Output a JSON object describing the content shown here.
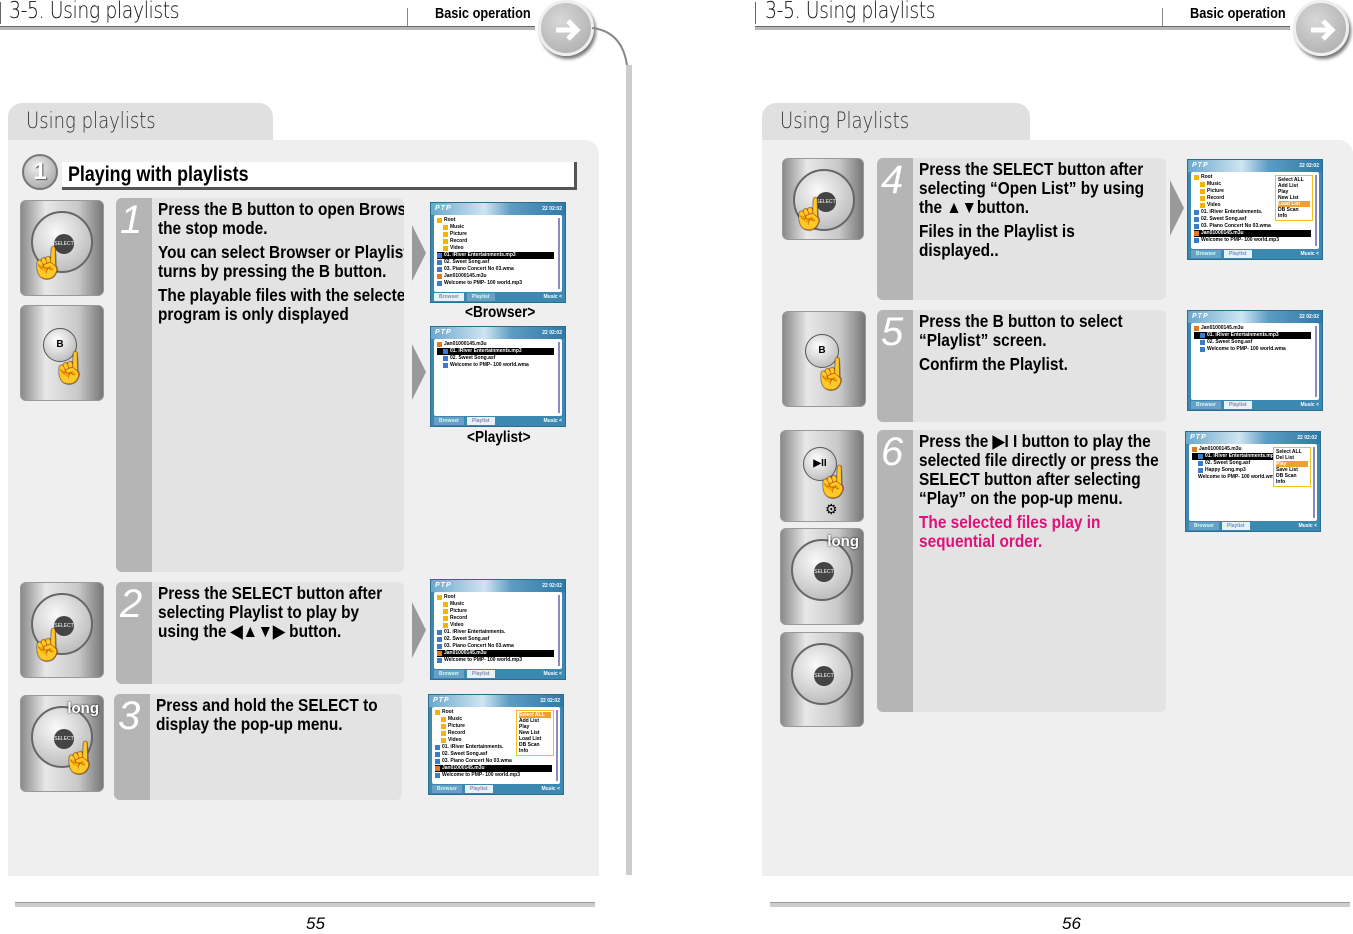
{
  "left_page": {
    "header": {
      "title": "3-5. Using playlists",
      "section": "Basic operation"
    },
    "tab": "Using playlists",
    "section_number": "1",
    "section_title": "Playing with playlists",
    "steps": [
      {
        "number": "1",
        "paragraphs": [
          "Press the B button to open Browser at the stop mode.",
          "You can select Browser or Playlist by turns by pressing the B button.",
          "The playable files with the selected program is only displayed"
        ]
      },
      {
        "number": "2",
        "paragraphs": [
          "Press the SELECT button after selecting Playlist to play by using the ◀▲▼▶ button."
        ]
      },
      {
        "number": "3",
        "paragraphs": [
          "Press and hold the SELECT to display the pop-up menu."
        ]
      }
    ],
    "captions": {
      "browser": "<Browser>",
      "playlist": "<Playlist>"
    },
    "page_number": "55"
  },
  "right_page": {
    "header": {
      "title": "3-5. Using playlists",
      "section": "Basic operation"
    },
    "tab": "Using Playlists",
    "steps": [
      {
        "number": "4",
        "paragraphs": [
          "Press the SELECT button after selecting “Open List” by using the ▲▼button.",
          "Files in the Playlist is displayed.."
        ]
      },
      {
        "number": "5",
        "paragraphs": [
          "Press the B button to select “Playlist” screen.",
          "Confirm the Playlist."
        ]
      },
      {
        "number": "6",
        "paragraphs": [
          "Press the ▶I I button to play the selected file directly or press the SELECT button after selecting “Play” on the pop-up menu."
        ],
        "note": "The selected files play in sequential order."
      }
    ],
    "page_number": "56"
  },
  "device_labels": {
    "select": "SELECT",
    "b": "B",
    "long": "long"
  },
  "screen_common": {
    "logo": "PTP",
    "status": "22 02:02",
    "tabs": [
      "Browser",
      "Playlist"
    ],
    "mode": "Music <"
  },
  "screens": {
    "s1_browser": {
      "active": "Browser",
      "rows": [
        {
          "t": "Root",
          "i": "folder"
        },
        {
          "t": "Music",
          "i": "folder",
          "d": 1
        },
        {
          "t": "Picture",
          "i": "folder",
          "d": 1
        },
        {
          "t": "Record",
          "i": "folder",
          "d": 1
        },
        {
          "t": "Video",
          "i": "folder",
          "d": 1
        },
        {
          "t": "01. iRiver Entertainments.mp3",
          "i": "file",
          "sel": true
        },
        {
          "t": "02. Sweet Song.asf",
          "i": "file"
        },
        {
          "t": "03. Piano Concert No 03.wma",
          "i": "file"
        },
        {
          "t": "Jan01000145.m3u",
          "i": "list"
        },
        {
          "t": "Welcome to PMP- 100 world.mp3",
          "i": "file"
        }
      ]
    },
    "s1_playlist": {
      "active": "Playlist",
      "rows": [
        {
          "t": "Jan01000145.m3u",
          "i": "list"
        },
        {
          "t": "01. iRiver Entertainments.mp3",
          "i": "file",
          "sel": true,
          "d": 1
        },
        {
          "t": "02. Sweet Song.asf",
          "i": "file",
          "d": 1
        },
        {
          "t": "Welcome to PMP- 100 world.wma",
          "i": "file",
          "d": 1
        }
      ]
    },
    "s2": {
      "active": "Playlist",
      "rows": [
        {
          "t": "Root",
          "i": "folder"
        },
        {
          "t": "Music",
          "i": "folder",
          "d": 1
        },
        {
          "t": "Picture",
          "i": "folder",
          "d": 1
        },
        {
          "t": "Record",
          "i": "folder",
          "d": 1
        },
        {
          "t": "Video",
          "i": "folder",
          "d": 1
        },
        {
          "t": "01. iRiver Entertainments.",
          "i": "file"
        },
        {
          "t": "02. Sweet Song.asf",
          "i": "file"
        },
        {
          "t": "03. Piano Concert No 03.wma",
          "i": "file"
        },
        {
          "t": "Jan01000145.m3u",
          "i": "list",
          "sel": true
        },
        {
          "t": "Welcome to PMP- 100 world.mp3",
          "i": "file"
        }
      ]
    },
    "s3": {
      "active": "Playlist",
      "rows": [
        {
          "t": "Root",
          "i": "folder"
        },
        {
          "t": "Music",
          "i": "folder",
          "d": 1
        },
        {
          "t": "Picture",
          "i": "folder",
          "d": 1
        },
        {
          "t": "Record",
          "i": "folder",
          "d": 1
        },
        {
          "t": "Video",
          "i": "folder",
          "d": 1
        },
        {
          "t": "01. iRiver Entertainments.",
          "i": "file"
        },
        {
          "t": "02. Sweet Song.asf",
          "i": "file"
        },
        {
          "t": "03. Piano Concert No 03.wma",
          "i": "file"
        },
        {
          "t": "Jan01000145.m3u",
          "i": "list",
          "sel": true
        },
        {
          "t": "Welcome to PMP- 100 world.mp3",
          "i": "file"
        }
      ],
      "menu": {
        "items": [
          "Select ALL",
          "Add List",
          "Play",
          "New List",
          "Load List",
          "DB Scan",
          "Info"
        ],
        "highlight": 0
      }
    },
    "s4": {
      "active": "Playlist",
      "rows": [
        {
          "t": "Root",
          "i": "folder"
        },
        {
          "t": "Music",
          "i": "folder",
          "d": 1
        },
        {
          "t": "Picture",
          "i": "folder",
          "d": 1
        },
        {
          "t": "Record",
          "i": "folder",
          "d": 1
        },
        {
          "t": "Video",
          "i": "folder",
          "d": 1
        },
        {
          "t": "01. iRiver Entertainments.",
          "i": "file"
        },
        {
          "t": "02. Sweet Song.asf",
          "i": "file"
        },
        {
          "t": "03. Piano Concert No 03.wma",
          "i": "file"
        },
        {
          "t": "Jan01000145.m3u",
          "i": "list",
          "sel": true
        },
        {
          "t": "Welcome to PMP- 100 world.mp3",
          "i": "file"
        }
      ],
      "menu": {
        "items": [
          "Select ALL",
          "Add List",
          "Play",
          "New List",
          "Load List",
          "DB Scan",
          "Info"
        ],
        "highlight": 4
      }
    },
    "s5": {
      "active": "Playlist",
      "rows": [
        {
          "t": "Jan01000145.m3u",
          "i": "list"
        },
        {
          "t": "01. iRiver Entertainments.mp3",
          "i": "file",
          "sel": true,
          "d": 1
        },
        {
          "t": "02. Sweet Song.asf",
          "i": "file",
          "d": 1
        },
        {
          "t": "Welcome to PMP- 100 world.wma",
          "i": "file",
          "d": 1
        }
      ]
    },
    "s6": {
      "active": "Playlist",
      "rows": [
        {
          "t": "Jan01000145.m3u",
          "i": "list"
        },
        {
          "t": "01. iRiver Entertainments.mp3",
          "i": "file",
          "sel": true,
          "d": 1
        },
        {
          "t": "02. Sweet Song.asf",
          "i": "file",
          "d": 1
        },
        {
          "t": "Happy Song.mp3",
          "i": "file",
          "d": 1
        },
        {
          "t": "Welcome to PMP- 100 world.wma",
          "i": "none",
          "d": 1
        }
      ],
      "menu": {
        "items": [
          "Select ALL",
          "Del List",
          "Play",
          "Save List",
          "DB Scan",
          "Info"
        ],
        "highlight": 2
      }
    }
  }
}
